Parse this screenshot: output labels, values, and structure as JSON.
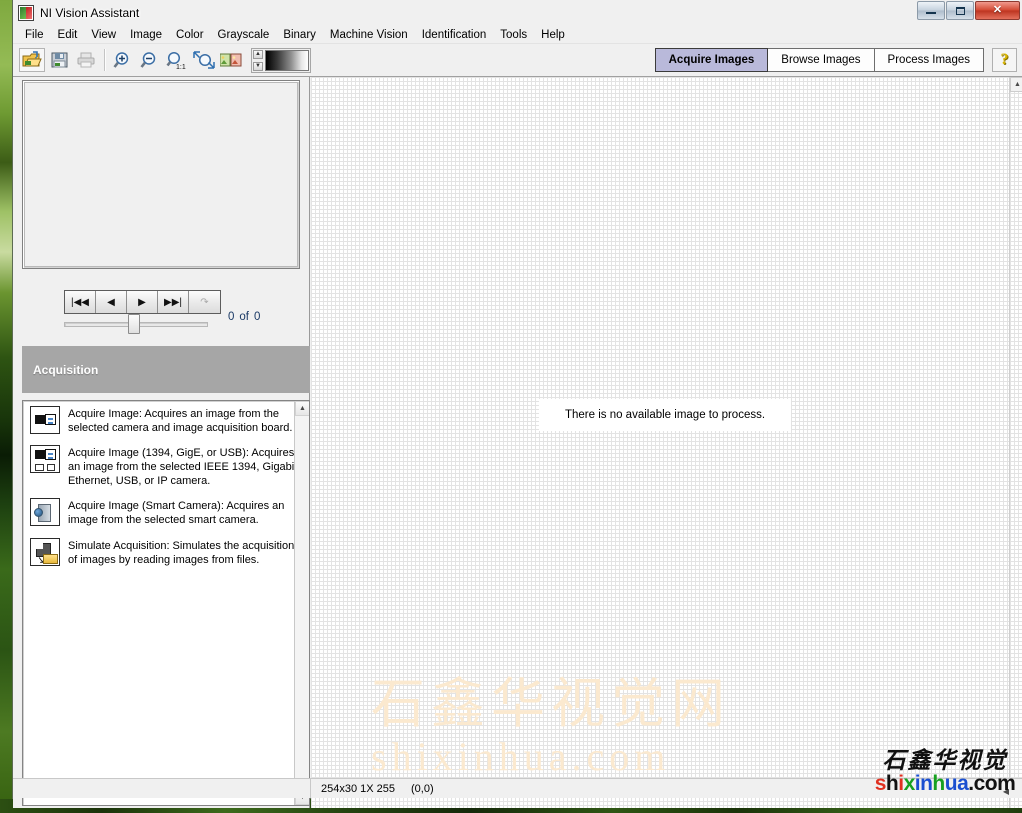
{
  "window": {
    "title": "NI Vision Assistant",
    "icon": "ni-vision-icon",
    "controls": {
      "minimize": "minimize-button",
      "maximize": "maximize-button",
      "close": "✕"
    }
  },
  "menubar": {
    "items": [
      {
        "label": "File"
      },
      {
        "label": "Edit"
      },
      {
        "label": "View"
      },
      {
        "label": "Image"
      },
      {
        "label": "Color"
      },
      {
        "label": "Grayscale"
      },
      {
        "label": "Binary"
      },
      {
        "label": "Machine Vision"
      },
      {
        "label": "Identification"
      },
      {
        "label": "Tools"
      },
      {
        "label": "Help"
      }
    ]
  },
  "toolbar": {
    "buttons": [
      {
        "name": "open-image-button",
        "icon": "open-folder-icon"
      },
      {
        "name": "save-image-button",
        "icon": "floppy-disk-icon"
      },
      {
        "name": "print-button",
        "icon": "printer-icon"
      },
      {
        "name": "zoom-in-button",
        "icon": "magnifier-plus-icon"
      },
      {
        "name": "zoom-out-button",
        "icon": "magnifier-minus-icon"
      },
      {
        "name": "zoom-actual-button",
        "icon": "magnifier-1to1-icon"
      },
      {
        "name": "zoom-fit-button",
        "icon": "magnifier-fit-icon"
      },
      {
        "name": "compare-images-button",
        "icon": "two-images-icon"
      }
    ],
    "ramp": {
      "name": "grayscale-ramp",
      "up": "▲",
      "down": "▼"
    }
  },
  "tabs": [
    {
      "label": "Acquire Images",
      "active": true
    },
    {
      "label": "Browse Images",
      "active": false
    },
    {
      "label": "Process Images",
      "active": false
    }
  ],
  "help_button": {
    "label": "?"
  },
  "navigation": {
    "buttons": [
      {
        "name": "first-image-button",
        "glyph": "|◀◀",
        "disabled": false
      },
      {
        "name": "previous-image-button",
        "glyph": "◀",
        "disabled": false
      },
      {
        "name": "next-image-button",
        "glyph": "▶",
        "disabled": false
      },
      {
        "name": "last-image-button",
        "glyph": "▶▶|",
        "disabled": false
      },
      {
        "name": "loop-button",
        "glyph": "↷",
        "disabled": true
      }
    ],
    "counter": {
      "current": "0",
      "separator": "of",
      "total": "0"
    }
  },
  "acquisition_panel": {
    "header": "Acquisition",
    "items": [
      {
        "icon": "camera-icon",
        "text": "Acquire Image:  Acquires an image from the selected camera and image acquisition board."
      },
      {
        "icon": "camera-network-icon",
        "text": "Acquire Image (1394, GigE, or USB):  Acquires an image from the selected IEEE 1394, Gigabit Ethernet, USB, or IP camera."
      },
      {
        "icon": "smart-camera-icon",
        "text": "Acquire Image (Smart Camera):  Acquires an image from the selected smart camera."
      },
      {
        "icon": "simulate-folder-icon",
        "text": "Simulate Acquisition:  Simulates the acquisition of images by reading images from files."
      }
    ],
    "scrollbar": {
      "up": "▲",
      "down": "▼"
    }
  },
  "canvas": {
    "message": "There is no available image to process.",
    "scrollbar": {
      "up": "▲"
    },
    "watermark": {
      "cn": "石鑫华视觉网",
      "en": "shixinhua.com"
    }
  },
  "statusbar": {
    "info": "254x30 1X 255",
    "coordinates": "(0,0)",
    "hscroll_glyph": "◀"
  },
  "corner_watermark": {
    "cn": "石鑫华视觉",
    "en_parts": [
      {
        "text": "s",
        "color": "#e03020"
      },
      {
        "text": "h",
        "color": "#111111"
      },
      {
        "text": "i",
        "color": "#e03020"
      },
      {
        "text": "x",
        "color": "#17a020"
      },
      {
        "text": "i",
        "color": "#1a4fd0"
      },
      {
        "text": "n",
        "color": "#1a4fd0"
      },
      {
        "text": "h",
        "color": "#17a020"
      },
      {
        "text": "u",
        "color": "#1a4fd0"
      },
      {
        "text": "a",
        "color": "#1a4fd0"
      },
      {
        "text": ".com",
        "color": "#111111"
      }
    ],
    "en": "shixinhua.com"
  },
  "colors": {
    "active_tab": "#b9b9da",
    "panel_header": "#a6a6a6",
    "window_bg": "#f0f0f0",
    "watermark": "#fbe9cf",
    "close_button": "#d34a33"
  }
}
